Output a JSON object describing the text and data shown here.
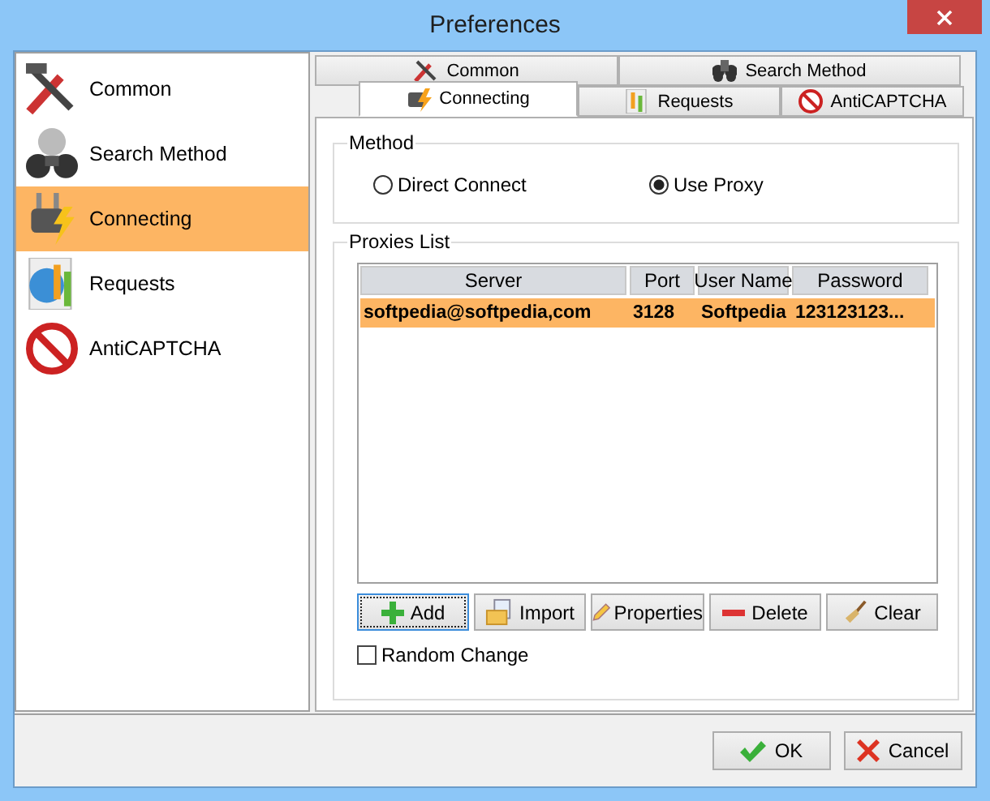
{
  "window": {
    "title": "Preferences"
  },
  "sidebar": {
    "items": [
      {
        "label": "Common",
        "selected": false
      },
      {
        "label": "Search Method",
        "selected": false
      },
      {
        "label": "Connecting",
        "selected": true
      },
      {
        "label": "Requests",
        "selected": false
      },
      {
        "label": "AntiCAPTCHA",
        "selected": false
      }
    ]
  },
  "tab_rows": [
    {
      "tabs": [
        {
          "label": "Common",
          "selected": false
        },
        {
          "label": "Search Method",
          "selected": false
        }
      ]
    },
    {
      "tabs": [
        {
          "label": "Connecting",
          "selected": true
        },
        {
          "label": "Requests",
          "selected": false
        },
        {
          "label": "AntiCAPTCHA",
          "selected": false
        }
      ]
    }
  ],
  "method": {
    "title": "Method",
    "options": [
      {
        "label": "Direct Connect",
        "selected": false
      },
      {
        "label": "Use Proxy",
        "selected": true
      }
    ]
  },
  "proxies": {
    "title": "Proxies List",
    "columns": [
      "Server",
      "Port",
      "User Name",
      "Password"
    ],
    "rows": [
      {
        "cells": [
          "softpedia@softpedia,com",
          "3128",
          "Softpedia",
          "123123123..."
        ],
        "selected": true
      }
    ],
    "buttons": [
      {
        "label": "Add",
        "focused": true
      },
      {
        "label": "Import",
        "focused": false
      },
      {
        "label": "Properties",
        "focused": false
      },
      {
        "label": "Delete",
        "focused": false
      },
      {
        "label": "Clear",
        "focused": false
      }
    ],
    "random_change": {
      "label": "Random Change",
      "checked": false
    }
  },
  "footer": {
    "buttons": [
      {
        "label": "OK"
      },
      {
        "label": "Cancel"
      }
    ]
  }
}
